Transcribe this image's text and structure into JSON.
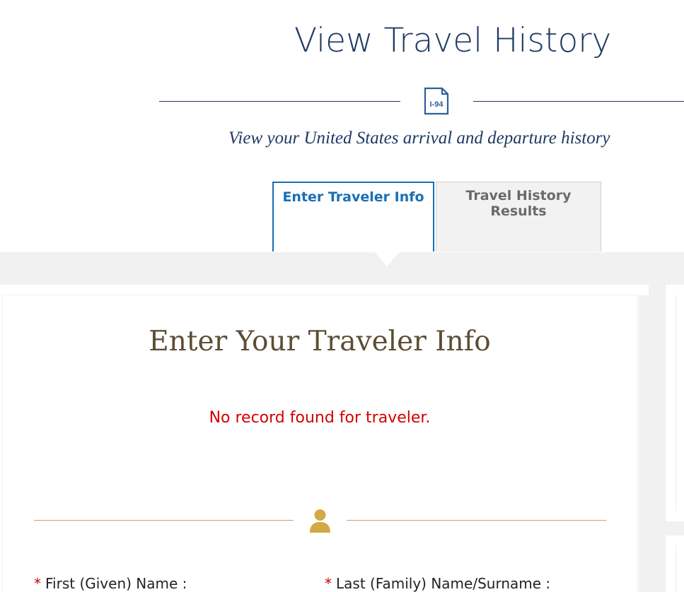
{
  "header": {
    "title": "View Travel History",
    "icon_label": "I-94",
    "subtitle": "View your United States arrival and departure history"
  },
  "tabs": [
    {
      "label": "Enter Traveler Info",
      "active": true
    },
    {
      "label": "Travel History Results",
      "active": false
    }
  ],
  "main": {
    "section_title": "Enter Your Traveler Info",
    "error_message": "No record found for traveler.",
    "person_icon": "user-icon",
    "fields": {
      "required_marker": "*",
      "first_name_label": "First (Given) Name :",
      "last_name_label": "Last (Family) Name/Surname :"
    }
  },
  "colors": {
    "title_blue": "#1f3a63",
    "tab_active_blue": "#1a6fb3",
    "section_title_brown": "#5c4d35",
    "error_red": "#d40000",
    "gold_accent": "#c9a75d",
    "band_gray": "#f1f1f1"
  }
}
